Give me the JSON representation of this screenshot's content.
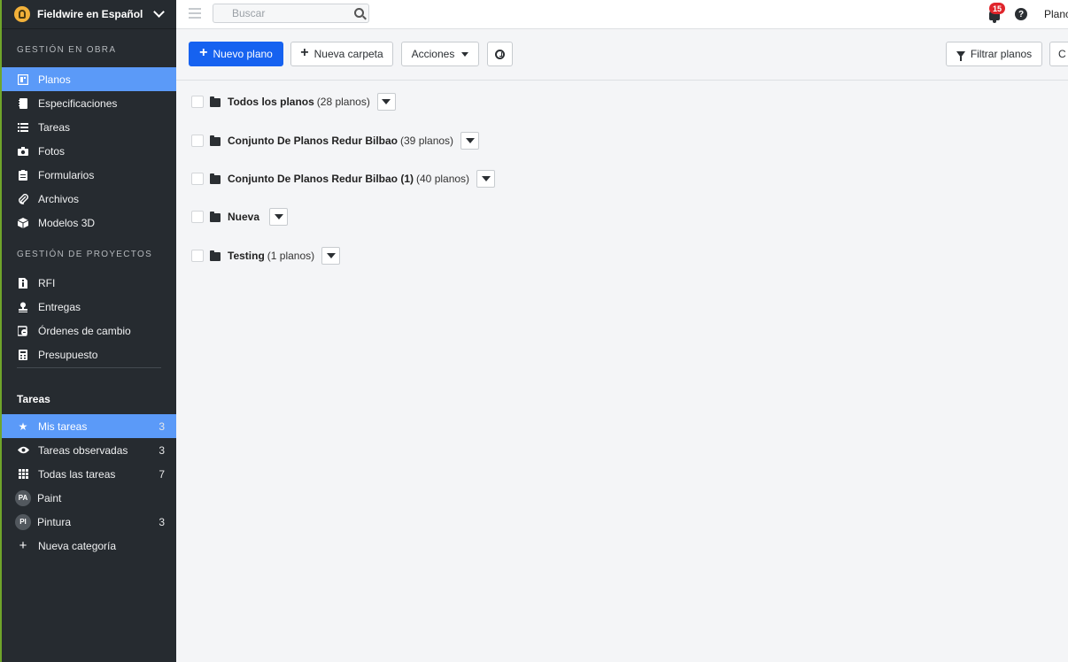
{
  "sidebar": {
    "brand_title": "Fieldwire en Español",
    "section_obra": "GESTIÓN EN OBRA",
    "obra_items": [
      {
        "label": "Planos",
        "icon": "plans-icon"
      },
      {
        "label": "Especificaciones",
        "icon": "specifications-icon"
      },
      {
        "label": "Tareas",
        "icon": "list-icon"
      },
      {
        "label": "Fotos",
        "icon": "camera-icon"
      },
      {
        "label": "Formularios",
        "icon": "clipboard-icon"
      },
      {
        "label": "Archivos",
        "icon": "paperclip-icon"
      },
      {
        "label": "Modelos 3D",
        "icon": "cube-icon"
      }
    ],
    "section_proyectos": "GESTIÓN DE PROYECTOS",
    "proyecto_items": [
      {
        "label": "RFI",
        "icon": "rfi-document-icon"
      },
      {
        "label": "Entregas",
        "icon": "stamp-icon"
      },
      {
        "label": "Órdenes de cambio",
        "icon": "change-order-icon"
      },
      {
        "label": "Presupuesto",
        "icon": "calculator-icon"
      }
    ],
    "tasks_heading": "Tareas",
    "task_items": [
      {
        "label": "Mis tareas",
        "count": "3",
        "icon": "star-icon"
      },
      {
        "label": "Tareas observadas",
        "count": "3",
        "icon": "eye-icon"
      },
      {
        "label": "Todas las tareas",
        "count": "7",
        "icon": "grid-icon"
      },
      {
        "label": "Paint",
        "count": "",
        "avatar": "PA"
      },
      {
        "label": "Pintura",
        "count": "3",
        "avatar": "PI"
      },
      {
        "label": "Nueva categoría",
        "count": "",
        "icon": "plus-icon"
      }
    ]
  },
  "topbar": {
    "search_placeholder": "Buscar",
    "notification_count": "15",
    "help_glyph": "?",
    "right_truncated": "Planc"
  },
  "toolbar": {
    "new_plan": "Nuevo plano",
    "new_folder": "Nueva carpeta",
    "actions": "Acciones",
    "filter": "Filtrar planos",
    "truncated": "C"
  },
  "folders": [
    {
      "name": "Todos los planos",
      "count": "(28 planos)"
    },
    {
      "name": "Conjunto De Planos Redur Bilbao",
      "count": "(39 planos)"
    },
    {
      "name": "Conjunto De Planos Redur Bilbao (1)",
      "count": "(40 planos)"
    },
    {
      "name": "Nueva",
      "count": ""
    },
    {
      "name": "Testing",
      "count": "(1 planos)"
    }
  ],
  "colors": {
    "sidebar_bg": "#262b30",
    "active_item": "#5b9af8",
    "primary_button": "#1662f0",
    "notification_badge": "#e0252b"
  }
}
